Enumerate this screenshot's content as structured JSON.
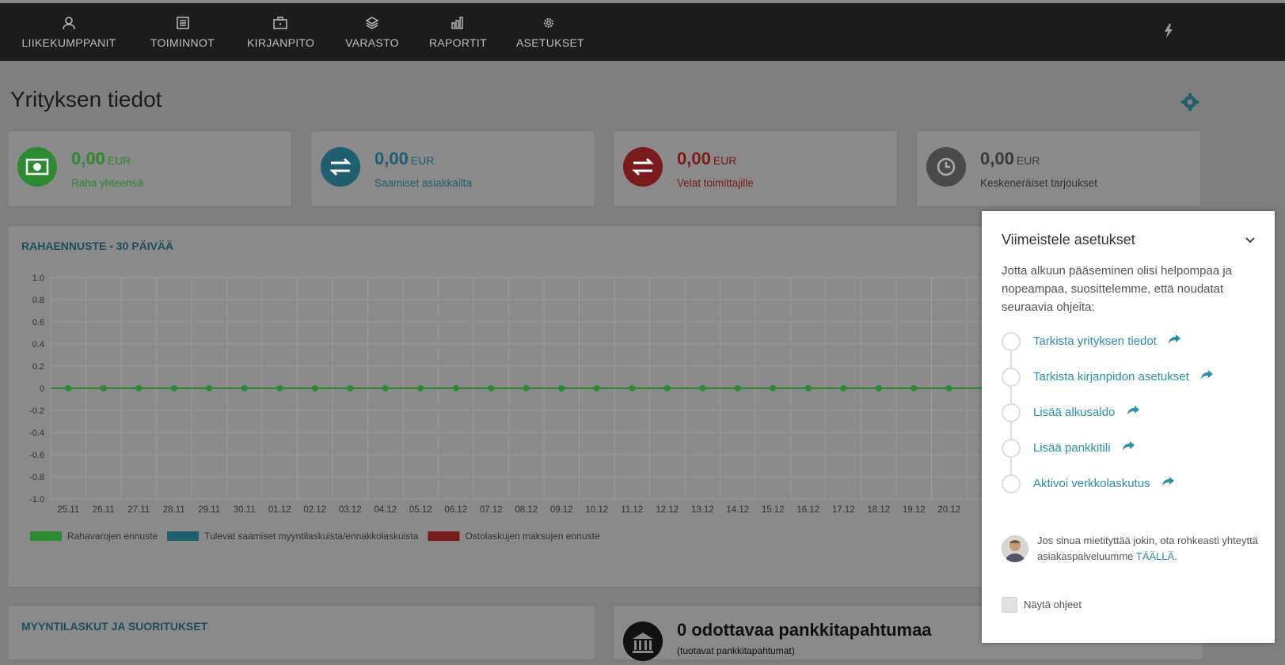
{
  "nav": {
    "items": [
      {
        "label": "LIIKEKUMPPANIT",
        "icon": "user-icon"
      },
      {
        "label": "TOIMINNOT",
        "icon": "list-icon"
      },
      {
        "label": "KIRJANPITO",
        "icon": "briefcase-icon"
      },
      {
        "label": "VARASTO",
        "icon": "layers-icon"
      },
      {
        "label": "RAPORTIT",
        "icon": "bar-chart-icon"
      },
      {
        "label": "ASETUKSET",
        "icon": "gear-icon"
      }
    ],
    "right_icon": "bolt-icon"
  },
  "page": {
    "title": "Yrityksen tiedot",
    "settings_icon": "gear-icon"
  },
  "cards": [
    {
      "value": "0,00",
      "unit": "EUR",
      "label": "Raha yhteensä",
      "color": "#2c8a31",
      "icon": "money-icon"
    },
    {
      "value": "0,00",
      "unit": "EUR",
      "label": "Saamiset asiakkailta",
      "color": "#1f5f70",
      "icon": "exchange-icon"
    },
    {
      "value": "0,00",
      "unit": "EUR",
      "label": "Velat toimittajille",
      "color": "#7a1b1b",
      "icon": "exchange-icon"
    },
    {
      "value": "0,00",
      "unit": "EUR",
      "label": "Keskeneräiset tarjoukset",
      "color": "#4a4a4a",
      "icon": "clock-icon"
    }
  ],
  "forecast": {
    "title": "RAHAENNUSTE - 30 PÄIVÄÄ"
  },
  "chart_data": {
    "type": "line",
    "title": "RAHAENNUSTE - 30 PÄIVÄÄ",
    "x": [
      "25.11",
      "26.11",
      "27.11",
      "28.11",
      "29.11",
      "30.11",
      "01.12",
      "02.12",
      "03.12",
      "04.12",
      "05.12",
      "06.12",
      "07.12",
      "08.12",
      "09.12",
      "10.12",
      "11.12",
      "12.12",
      "13.12",
      "14.12",
      "15.12",
      "16.12",
      "17.12",
      "18.12",
      "19.12",
      "20.12"
    ],
    "y_ticks": [
      "1.0",
      "0.8",
      "0.6",
      "0.4",
      "0.2",
      "0",
      "-0.2",
      "-0.4",
      "-0.6",
      "-0.8",
      "-1.0"
    ],
    "ylim": [
      -1.0,
      1.0
    ],
    "grid": true,
    "legend_position": "bottom-left",
    "series": [
      {
        "name": "Rahavarojen ennuste",
        "color": "#2c8a31",
        "values": [
          0,
          0,
          0,
          0,
          0,
          0,
          0,
          0,
          0,
          0,
          0,
          0,
          0,
          0,
          0,
          0,
          0,
          0,
          0,
          0,
          0,
          0,
          0,
          0,
          0,
          0
        ]
      }
    ],
    "legend": [
      {
        "name": "Rahavarojen ennuste",
        "color": "#2c8a31"
      },
      {
        "name": "Tulevat saamiset myyntilaskuista/ennakkolaskuista",
        "color": "#1f5f70"
      },
      {
        "name": "Ostolaskujen maksujen ennuste",
        "color": "#7a1b1b"
      }
    ]
  },
  "sales": {
    "title": "MYYNTILASKUT JA SUORITUKSET"
  },
  "bank": {
    "title": "0 odottavaa pankkitapahtumaa",
    "subtitle": "(tuotavat pankkitapahtumat)",
    "icon": "bank-icon"
  },
  "popup": {
    "title": "Viimeistele asetukset",
    "intro": "Jotta alkuun pääseminen olisi helpompaa ja nopeampaa, suosittelemme, että noudatat seuraavia ohjeita:",
    "steps": [
      {
        "label": "Tarkista yrityksen tiedot"
      },
      {
        "label": "Tarkista kirjanpidon asetukset"
      },
      {
        "label": "Lisää alkusaldo"
      },
      {
        "label": "Lisää pankkitili"
      },
      {
        "label": "Aktivoi verkkolaskutus"
      }
    ],
    "help_text": "Jos sinua mietityttää jokin, ota rohkeasti yhteyttä asiakaspalveluumme ",
    "help_link": "TÄÄLLÄ",
    "help_end": ".",
    "show_label": "Näytä ohjeet",
    "accent": "#2a8fad"
  }
}
